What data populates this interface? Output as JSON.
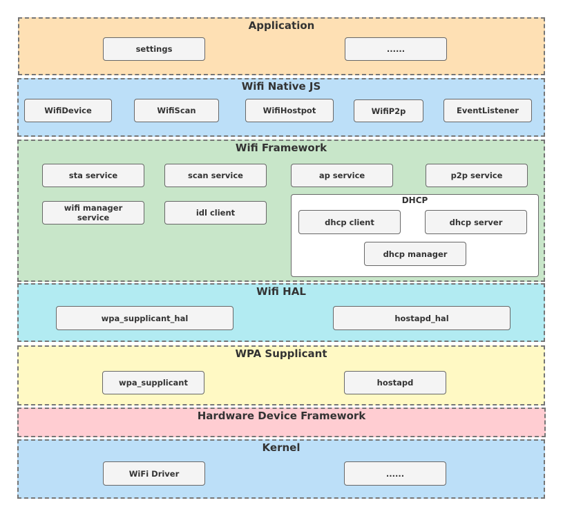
{
  "layers": {
    "application": {
      "title": "Application",
      "color": "#fee0b4",
      "components": [
        "settings",
        "......"
      ]
    },
    "native_js": {
      "title": "Wifi Native JS",
      "color": "#bcdff8",
      "components": [
        "WifiDevice",
        "WifiScan",
        "WifiHostpot",
        "WifiP2p",
        "EventListener"
      ]
    },
    "framework": {
      "title": "Wifi Framework",
      "color": "#c8e6c9",
      "components": [
        "sta service",
        "scan service",
        "ap service",
        "p2p service",
        "wifi manager service",
        "idl client"
      ],
      "dhcp": {
        "title": "DHCP",
        "components": [
          "dhcp client",
          "dhcp server",
          "dhcp manager"
        ]
      }
    },
    "hal": {
      "title": "Wifi HAL",
      "color": "#b2ebf2",
      "components": [
        "wpa_supplicant_hal",
        "hostapd_hal"
      ]
    },
    "wpa": {
      "title": "WPA Supplicant",
      "color": "#fff9c4",
      "components": [
        "wpa_supplicant",
        "hostapd"
      ]
    },
    "hardware": {
      "title": "Hardware Device Framework",
      "color": "#ffcdd2"
    },
    "kernel": {
      "title": "Kernel",
      "color": "#bcdff8",
      "components": [
        "WiFi Driver",
        "......"
      ]
    }
  }
}
